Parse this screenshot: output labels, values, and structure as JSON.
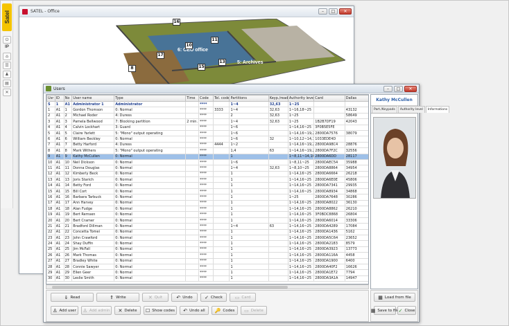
{
  "brand": {
    "logo_text": "Satel"
  },
  "sidebar": {
    "ip_label": "IP"
  },
  "back_window": {
    "title": "SATEL - Office",
    "rooms": [
      {
        "num": "16",
        "label": "6: CEO office"
      },
      {
        "num": "15"
      },
      {
        "num": "13",
        "label": "5: Archives"
      },
      {
        "num": "17"
      },
      {
        "num": "8"
      },
      {
        "num": "10"
      },
      {
        "num": "11"
      }
    ]
  },
  "users_window": {
    "title": "Users",
    "columns": [
      "Usr",
      "ID",
      "No",
      "User name",
      "Type",
      "Time",
      "Code",
      "Tel. code",
      "Partitions",
      "Keyp./reader",
      "Authority level",
      "Card",
      "Dallas"
    ],
    "rows": [
      [
        "S",
        "1",
        "A1",
        "Administrator 1",
        "Administrator",
        "",
        "****",
        "",
        "1~4",
        "32,63",
        "1~25",
        "",
        ""
      ],
      [
        "1",
        "A1",
        "1",
        "Gordon Thomson",
        "0: Normal",
        "",
        "****",
        "3333",
        "1~4",
        "32,63",
        "1~16,18~25",
        "",
        "43132"
      ],
      [
        "2",
        "A1",
        "2",
        "Michael Roder",
        "4: Duress",
        "",
        "****",
        "",
        "2",
        "32,63",
        "1~25",
        "",
        "58649"
      ],
      [
        "3",
        "A1",
        "3",
        "Pamela Bellwood",
        "7: Blocking partition",
        "2 min.",
        "****",
        "",
        "1~4",
        "32,63",
        "1~25",
        "1B2B7DF19",
        "42043"
      ],
      [
        "4",
        "A1",
        "4",
        "Calvin Lockhart",
        "3: Guard",
        "",
        "****",
        "",
        "1~6",
        "",
        "1~14,16~25",
        "3F0B5E5FE",
        ""
      ],
      [
        "5",
        "A1",
        "5",
        "Claire Yarlett",
        "5: \"Mono\" output operating",
        "",
        "****",
        "",
        "1~6",
        "",
        "1~14,16~19,22~25",
        "2800DA7576",
        "38079"
      ],
      [
        "6",
        "A1",
        "6",
        "William Beckley",
        "0: Normal",
        "",
        "****",
        "",
        "1~6",
        "32",
        "1~10,12~14,16~19,22~25",
        "1033EDE4D",
        ""
      ],
      [
        "7",
        "A1",
        "7",
        "Betty Harford",
        "4: Duress",
        "",
        "****",
        "4444",
        "1~2",
        "",
        "1~14,16~19,22~25",
        "2800DA98C4",
        "28876"
      ],
      [
        "8",
        "A1",
        "8",
        "Mark Withers",
        "5: \"Mono\" output operating",
        "",
        "****",
        "",
        "1,4",
        "63",
        "1~14,16~19,22~25",
        "2800DA7F2C",
        "32556"
      ],
      [
        "9",
        "A1",
        "9",
        "Kathy McCullen",
        "0: Normal",
        "",
        "****",
        "",
        "1",
        "",
        "1~8,11~14,16~19,22~25",
        "2800DA6DD",
        "28117"
      ],
      [
        "10",
        "A1",
        "10",
        "Neil Dickson",
        "0: Normal",
        "",
        "****",
        "",
        "1~6",
        "",
        "1~8,11~25",
        "2800DAEC54",
        "35988"
      ],
      [
        "11",
        "A1",
        "11",
        "Donna Douglas",
        "0: Normal",
        "",
        "****",
        "",
        "1~4",
        "32,63",
        "1~8,10~25",
        "2800DA8864",
        "34954"
      ],
      [
        "12",
        "A1",
        "12",
        "Kimberly Beck",
        "0: Normal",
        "",
        "****",
        "",
        "1",
        "",
        "1~14,16~25",
        "2800DA6664",
        "26218"
      ],
      [
        "13",
        "A1",
        "13",
        "Joris Starich",
        "0: Normal",
        "",
        "****",
        "",
        "1",
        "",
        "1~14,16~25",
        "2800DA6E0E",
        "45806"
      ],
      [
        "14",
        "A1",
        "14",
        "Betty Ford",
        "0: Normal",
        "",
        "****",
        "",
        "1",
        "",
        "1~14,16~25",
        "2800DA7341",
        "29935"
      ],
      [
        "15",
        "A1",
        "15",
        "Bill Cort",
        "0: Normal",
        "",
        "****",
        "",
        "1",
        "",
        "1~14,16~25",
        "2800DA8934",
        "34868"
      ],
      [
        "16",
        "A1",
        "16",
        "Barbara Tarbuck",
        "0: Normal",
        "",
        "****",
        "",
        "1",
        "",
        "1~25",
        "2800DA7648",
        "30286"
      ],
      [
        "17",
        "A1",
        "17",
        "Ann Harvey",
        "0: Normal",
        "",
        "****",
        "",
        "1",
        "",
        "1~14,16~25",
        "2800DA8022",
        "36130"
      ],
      [
        "18",
        "A1",
        "18",
        "Alan Fudge",
        "0: Normal",
        "",
        "****",
        "",
        "1",
        "",
        "1~14,16~25",
        "2800DA8862",
        "26210"
      ],
      [
        "19",
        "A1",
        "19",
        "Bert Remsen",
        "0: Normal",
        "",
        "****",
        "",
        "1",
        "",
        "1~14,16~25",
        "3F0BDC8868",
        "26804"
      ],
      [
        "20",
        "A1",
        "20",
        "Bert Cramer",
        "0: Normal",
        "",
        "****",
        "",
        "1",
        "",
        "1~14,16~25",
        "2800DA6014",
        "33306"
      ],
      [
        "21",
        "A1",
        "21",
        "Bradford Dillman",
        "0: Normal",
        "",
        "****",
        "",
        "1~4",
        "63",
        "1~14,16~25",
        "2800DA4289",
        "17084"
      ],
      [
        "22",
        "A1",
        "22",
        "Concetta Tomei",
        "0: Normal",
        "",
        "****",
        "",
        "1",
        "",
        "1~14,16~25",
        "2800DA1436",
        "5162"
      ],
      [
        "23",
        "A1",
        "23",
        "John Crawford",
        "0: Normal",
        "",
        "****",
        "",
        "1",
        "",
        "1~14,16~25",
        "2800DA5C64",
        "23652"
      ],
      [
        "24",
        "A1",
        "24",
        "Shay Duffin",
        "0: Normal",
        "",
        "****",
        "",
        "1",
        "",
        "1~14,16~25",
        "2800DA2183",
        "8579"
      ],
      [
        "25",
        "A1",
        "25",
        "Jim McFall",
        "0: Normal",
        "",
        "****",
        "",
        "1",
        "",
        "1~14,16~25",
        "2800DA3923",
        "13773"
      ],
      [
        "26",
        "A1",
        "26",
        "Mark Thomas",
        "0: Normal",
        "",
        "****",
        "",
        "1",
        "",
        "1~14,16~25",
        "2800DA116A",
        "4458"
      ],
      [
        "27",
        "A1",
        "27",
        "Bradley White",
        "0: Normal",
        "",
        "****",
        "",
        "1",
        "",
        "1~14,16~25",
        "2800DA1900",
        "6400"
      ],
      [
        "28",
        "A1",
        "28",
        "Connie Sawyer",
        "0: Normal",
        "",
        "****",
        "",
        "1",
        "",
        "1~14,16~25",
        "2800DA40F2",
        "16626"
      ],
      [
        "29",
        "A1",
        "29",
        "Ellen Geer",
        "0: Normal",
        "",
        "****",
        "",
        "1",
        "",
        "1~14,16~25",
        "2800DA1E72",
        "7794"
      ],
      [
        "30",
        "A1",
        "30",
        "Leslie Smith",
        "0: Normal",
        "",
        "****",
        "",
        "1",
        "",
        "1~14,16~25",
        "2800DA3A1A",
        "14947"
      ]
    ],
    "selected_row_index": 9,
    "right_panel": {
      "name": "Kathy McCullen",
      "tabs": [
        "Part./Keypads",
        "Authority level",
        "Informations"
      ],
      "active_tab_index": 2
    },
    "toolbar": {
      "read": "Read",
      "write": "Write",
      "quit": "Quit",
      "undo": "Undo",
      "check": "Check",
      "card": "Card",
      "add_user": "Add user",
      "add_admin": "Add admin",
      "delete": "Delete",
      "show_codes": "Show codes",
      "undo_all": "Undo all",
      "codes": "Codes",
      "delete2": "Delete"
    },
    "right_toolbar": {
      "load_from_file": "Load from file",
      "save_to_file": "Save to file",
      "close": "Close"
    }
  },
  "colors": {
    "accent_yellow": "#f5c400",
    "selected_row": "#9ec0e8",
    "admin_text": "#1f3f8f",
    "name_blue": "#2b5ea7"
  }
}
